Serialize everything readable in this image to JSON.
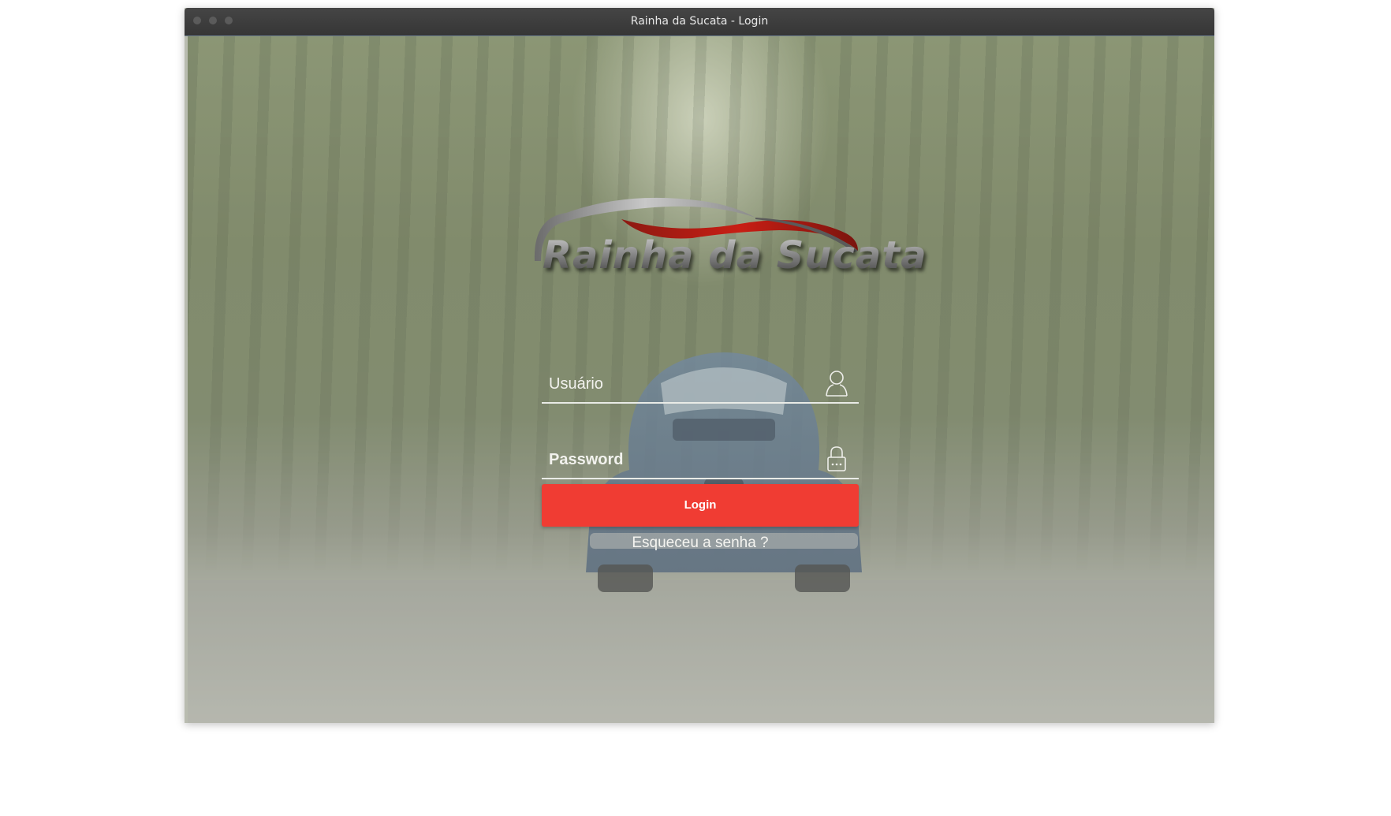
{
  "window": {
    "title": "Rainha da Sucata - Login"
  },
  "logo": {
    "text": "Rainha da Sucata"
  },
  "form": {
    "username_placeholder": "Usuário",
    "password_placeholder": "Password",
    "username_icon": "user-icon",
    "password_icon": "lock-icon",
    "login_label": "Login",
    "forgot_label": "Esqueceu a senha ?"
  },
  "colors": {
    "titlebar": "#3c3c3c",
    "login_button": "#f03c33",
    "field_line": "#e9ebe6",
    "logo_swoosh_red": "#c81e14"
  }
}
